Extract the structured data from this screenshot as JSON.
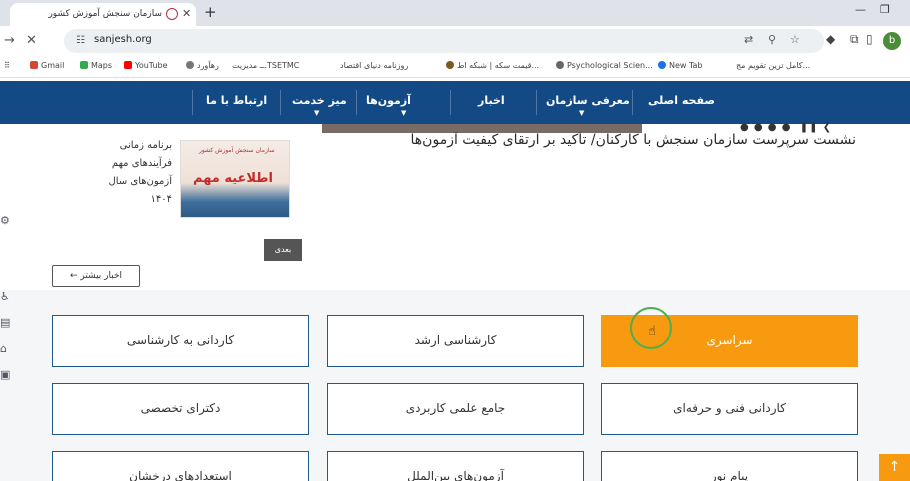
{
  "browser": {
    "tab_title": "سازمان سنجش آموزش کشور",
    "url": "sanjesh.org",
    "avatar_letter": "b",
    "bookmarks": [
      "Gmail",
      "Maps",
      "YouTube",
      "رهآورد",
      "TSETMC.ــ مدیریت",
      "روزنامه دنیای اقتصاد",
      "قیمت سکه | شبکه اط...",
      "Psychological Scien...",
      "New Tab",
      "کامل ترین تقویم مج..."
    ]
  },
  "nav": {
    "home": "صفحه اصلی",
    "about": "معرفی سازمان",
    "news": "اخبار",
    "exams": "آزمون‌ها",
    "service": "میز خدمت",
    "contact": "ارتباط با ما"
  },
  "news": {
    "headline": "نشست سرپرست سازمان سنجش با کارکنان/ تأکید بر ارتقای کیفیت آزمون‌ها",
    "notice_top": "سازمان سنجش آموزش کشور",
    "notice_big": "اطلاعیه مهم",
    "schedule_lines": [
      "برنامه زمانی",
      "فرآیندهای مهم",
      "آزمون‌های سال",
      "۱۴۰۴"
    ],
    "next_label": "بعدی",
    "more_news": "اخبار بیشتر ←"
  },
  "categories": [
    "سراسری",
    "کارشناسی ارشد",
    "کاردانی به کارشناسی",
    "کاردانی فنی و حرفه‌ای",
    "جامع علمی کاربردی",
    "دکترای تخصصی",
    "پیام نور",
    "آزمون‌های بین‌الملل",
    "استعدادهای درخشان"
  ],
  "colors": {
    "navbar": "#134a86",
    "accent_orange": "#f79a10",
    "button_border": "#1e5b8f"
  }
}
